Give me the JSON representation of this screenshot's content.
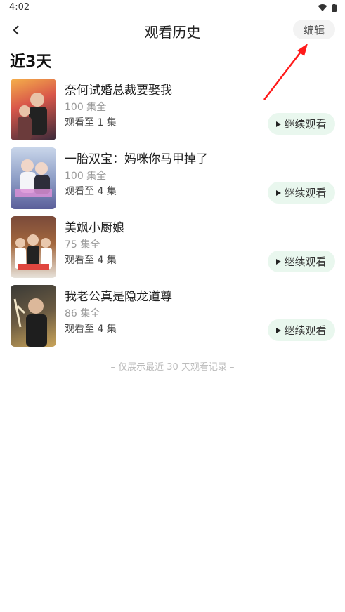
{
  "status_bar": {
    "time": "4:02"
  },
  "header": {
    "title": "观看历史",
    "edit_label": "编辑"
  },
  "section": {
    "title": "近3天"
  },
  "items": [
    {
      "title": "奈何试婚总裁要娶我",
      "episodes": "100 集全",
      "progress": "观看至 1 集",
      "button": "继续观看"
    },
    {
      "title": "一胎双宝：妈咪你马甲掉了",
      "episodes": "100 集全",
      "progress": "观看至 4 集",
      "button": "继续观看"
    },
    {
      "title": "美飒小厨娘",
      "episodes": "75 集全",
      "progress": "观看至 4 集",
      "button": "继续观看"
    },
    {
      "title": "我老公真是隐龙道尊",
      "episodes": "86 集全",
      "progress": "观看至 4 集",
      "button": "继续观看"
    }
  ],
  "footer": {
    "note": "– 仅展示最近 30 天观看记录 –"
  },
  "colors": {
    "accent_bg": "#e9f7ee",
    "annotation": "#ff1a1a"
  }
}
